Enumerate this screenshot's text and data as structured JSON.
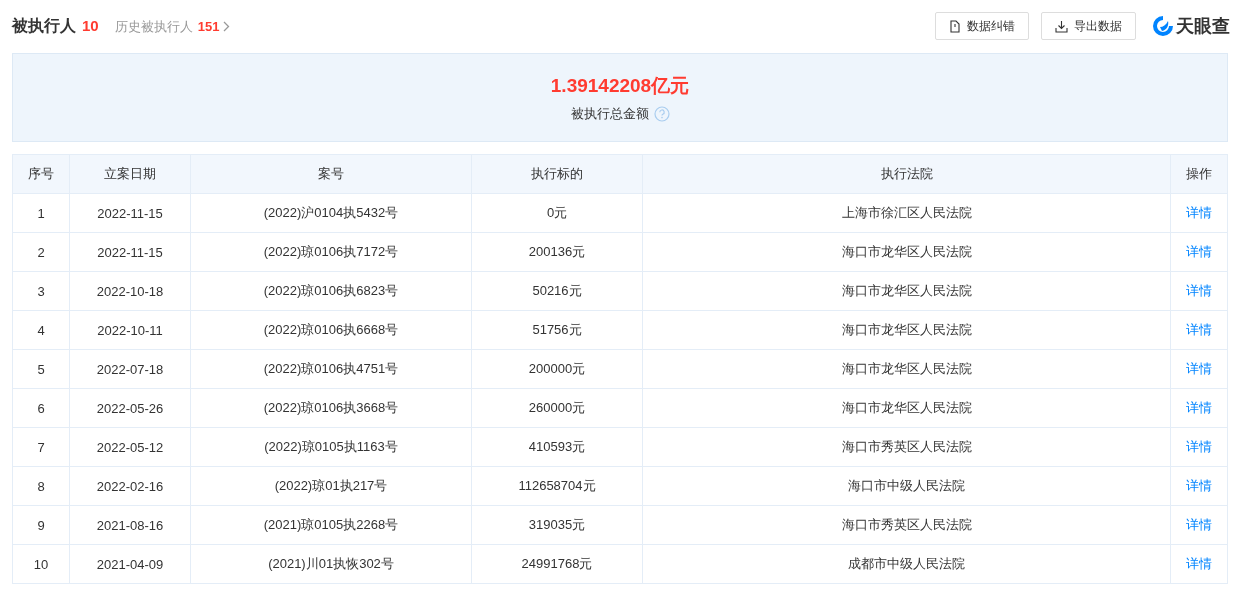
{
  "header": {
    "title": "被执行人",
    "count": "10",
    "history_label": "历史被执行人",
    "history_count": "151",
    "buttons": [
      {
        "kind": "report",
        "label": "数据纠错"
      },
      {
        "kind": "export",
        "label": "导出数据"
      }
    ],
    "logo": "天眼查"
  },
  "summary": {
    "amount": "1.39142208亿元",
    "label": "被执行总金额"
  },
  "table": {
    "columns": [
      "序号",
      "立案日期",
      "案号",
      "执行标的",
      "执行法院",
      "操作"
    ],
    "rows": [
      [
        "1",
        "2022-11-15",
        "(2022)沪0104执5432号",
        "0元",
        "上海市徐汇区人民法院",
        "详情"
      ],
      [
        "2",
        "2022-11-15",
        "(2022)琼0106执7172号",
        "200136元",
        "海口市龙华区人民法院",
        "详情"
      ],
      [
        "3",
        "2022-10-18",
        "(2022)琼0106执6823号",
        "50216元",
        "海口市龙华区人民法院",
        "详情"
      ],
      [
        "4",
        "2022-10-11",
        "(2022)琼0106执6668号",
        "51756元",
        "海口市龙华区人民法院",
        "详情"
      ],
      [
        "5",
        "2022-07-18",
        "(2022)琼0106执4751号",
        "200000元",
        "海口市龙华区人民法院",
        "详情"
      ],
      [
        "6",
        "2022-05-26",
        "(2022)琼0106执3668号",
        "260000元",
        "海口市龙华区人民法院",
        "详情"
      ],
      [
        "7",
        "2022-05-12",
        "(2022)琼0105执1163号",
        "410593元",
        "海口市秀英区人民法院",
        "详情"
      ],
      [
        "8",
        "2022-02-16",
        "(2022)琼01执217号",
        "112658704元",
        "海口市中级人民法院",
        "详情"
      ],
      [
        "9",
        "2021-08-16",
        "(2021)琼0105执2268号",
        "319035元",
        "海口市秀英区人民法院",
        "详情"
      ],
      [
        "10",
        "2021-04-09",
        "(2021)川01执恢302号",
        "24991768元",
        "成都市中级人民法院",
        "详情"
      ]
    ]
  }
}
